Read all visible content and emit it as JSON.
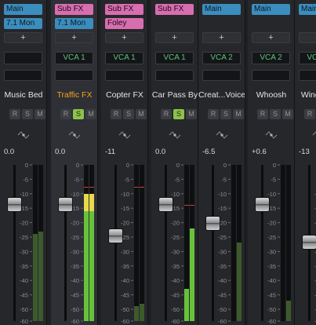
{
  "channels": [
    {
      "name": "Music Bed",
      "assign1": "Main",
      "assign1_type": "main",
      "assign2": "7.1 Mon",
      "assign2_type": "mon",
      "add_label": "+",
      "vca": "",
      "solo": false,
      "selected": false,
      "volume": "0.0",
      "fader_db": 0.0,
      "meter_l_db": -24,
      "meter_r_db": -23
    },
    {
      "name": "Traffic FX",
      "assign1": "Sub FX",
      "assign1_type": "sub",
      "assign2": "7.1 Mon",
      "assign2_type": "mon",
      "add_label": "+",
      "vca": "VCA 1",
      "solo": true,
      "selected": true,
      "volume": "0.0",
      "fader_db": 0.0,
      "meter_l_db": -10,
      "meter_r_db": -10,
      "peak_db": -8
    },
    {
      "name": "Copter FX",
      "assign1": "Sub FX",
      "assign1_type": "sub",
      "assign2": "Foley",
      "assign2_type": "foley",
      "add_label": "+",
      "vca": "VCA 1",
      "solo": false,
      "selected": false,
      "volume": "-11",
      "fader_db": -11,
      "meter_l_db": -49,
      "meter_r_db": -48,
      "peak_db": -8
    },
    {
      "name": "Car Pass By",
      "assign1": "Sub FX",
      "assign1_type": "sub",
      "assign2": "",
      "assign2_type": "",
      "add_label": "+",
      "vca": "VCA 1",
      "solo": true,
      "selected": false,
      "volume": "0.0",
      "fader_db": 0.0,
      "meter_l_db": -43,
      "meter_r_db": -22,
      "peak_db": -14
    },
    {
      "name": "Creat...Voice",
      "assign1": "Main",
      "assign1_type": "main",
      "assign2": "",
      "assign2_type": "",
      "add_label": "+",
      "vca": "VCA 2",
      "solo": false,
      "selected": false,
      "volume": "-6.5",
      "fader_db": -6.5,
      "meter_l_db": -60,
      "meter_r_db": -27
    },
    {
      "name": "Whoosh",
      "assign1": "Main",
      "assign1_type": "main",
      "assign2": "",
      "assign2_type": "",
      "add_label": "+",
      "vca": "VCA 2",
      "solo": false,
      "selected": false,
      "volume": "+0.6",
      "fader_db": 0.6,
      "meter_l_db": -60,
      "meter_r_db": -47
    },
    {
      "name": "Wingman",
      "assign1": "Main",
      "assign1_type": "main",
      "assign2": "",
      "assign2_type": "",
      "add_label": "+",
      "vca": "VCA 2",
      "solo": false,
      "selected": false,
      "volume": "-13",
      "fader_db": -13,
      "meter_l_db": -60,
      "meter_r_db": -27
    }
  ],
  "buttons": {
    "record": "R",
    "solo": "S",
    "mute": "M"
  },
  "scale_labels": [
    "0",
    "-5",
    "-10",
    "-15",
    "-20",
    "-25",
    "-30",
    "-35",
    "-40",
    "-45",
    "-50",
    "-60"
  ],
  "colors": {
    "main": "#3b8dbd",
    "sub": "#d86db0",
    "vca_text": "#5fc27a",
    "meter_green": "#67c23a",
    "meter_yellow": "#e8d84a",
    "selected_name": "#f0a31e",
    "solo_on": "#8bc34a"
  }
}
